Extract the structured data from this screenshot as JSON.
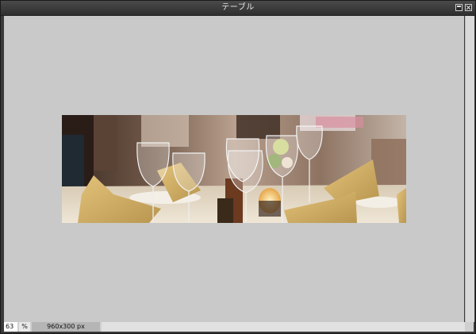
{
  "window": {
    "title": "テーブル"
  },
  "image": {
    "subject": "restaurant table setting with wine glasses, folded napkins, candle and flowers"
  },
  "status": {
    "zoom_value": "63",
    "zoom_unit": "%",
    "image_size": "960x300 px"
  },
  "colors": {
    "canvas": "#c9c9c9",
    "titlebar": "#3a3a3a",
    "napkin": "#d9b86a"
  }
}
